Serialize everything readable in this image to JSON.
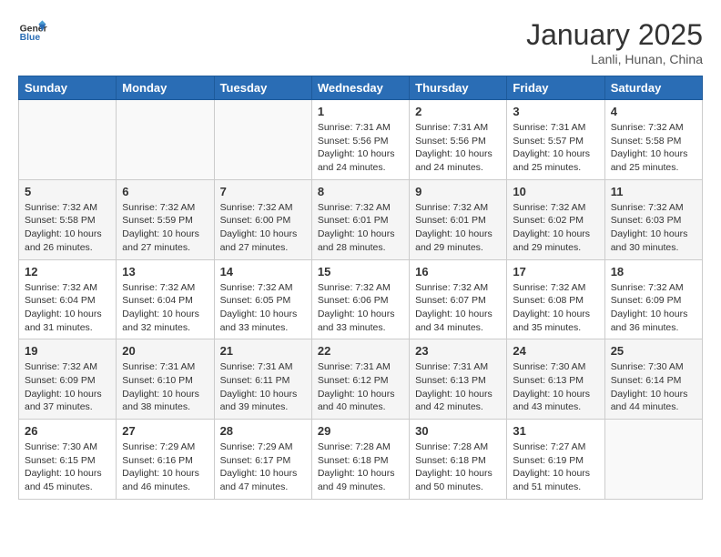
{
  "header": {
    "logo_line1": "General",
    "logo_line2": "Blue",
    "month_title": "January 2025",
    "location": "Lanli, Hunan, China"
  },
  "weekdays": [
    "Sunday",
    "Monday",
    "Tuesday",
    "Wednesday",
    "Thursday",
    "Friday",
    "Saturday"
  ],
  "weeks": [
    [
      {
        "day": "",
        "info": ""
      },
      {
        "day": "",
        "info": ""
      },
      {
        "day": "",
        "info": ""
      },
      {
        "day": "1",
        "info": "Sunrise: 7:31 AM\nSunset: 5:56 PM\nDaylight: 10 hours\nand 24 minutes."
      },
      {
        "day": "2",
        "info": "Sunrise: 7:31 AM\nSunset: 5:56 PM\nDaylight: 10 hours\nand 24 minutes."
      },
      {
        "day": "3",
        "info": "Sunrise: 7:31 AM\nSunset: 5:57 PM\nDaylight: 10 hours\nand 25 minutes."
      },
      {
        "day": "4",
        "info": "Sunrise: 7:32 AM\nSunset: 5:58 PM\nDaylight: 10 hours\nand 25 minutes."
      }
    ],
    [
      {
        "day": "5",
        "info": "Sunrise: 7:32 AM\nSunset: 5:58 PM\nDaylight: 10 hours\nand 26 minutes."
      },
      {
        "day": "6",
        "info": "Sunrise: 7:32 AM\nSunset: 5:59 PM\nDaylight: 10 hours\nand 27 minutes."
      },
      {
        "day": "7",
        "info": "Sunrise: 7:32 AM\nSunset: 6:00 PM\nDaylight: 10 hours\nand 27 minutes."
      },
      {
        "day": "8",
        "info": "Sunrise: 7:32 AM\nSunset: 6:01 PM\nDaylight: 10 hours\nand 28 minutes."
      },
      {
        "day": "9",
        "info": "Sunrise: 7:32 AM\nSunset: 6:01 PM\nDaylight: 10 hours\nand 29 minutes."
      },
      {
        "day": "10",
        "info": "Sunrise: 7:32 AM\nSunset: 6:02 PM\nDaylight: 10 hours\nand 29 minutes."
      },
      {
        "day": "11",
        "info": "Sunrise: 7:32 AM\nSunset: 6:03 PM\nDaylight: 10 hours\nand 30 minutes."
      }
    ],
    [
      {
        "day": "12",
        "info": "Sunrise: 7:32 AM\nSunset: 6:04 PM\nDaylight: 10 hours\nand 31 minutes."
      },
      {
        "day": "13",
        "info": "Sunrise: 7:32 AM\nSunset: 6:04 PM\nDaylight: 10 hours\nand 32 minutes."
      },
      {
        "day": "14",
        "info": "Sunrise: 7:32 AM\nSunset: 6:05 PM\nDaylight: 10 hours\nand 33 minutes."
      },
      {
        "day": "15",
        "info": "Sunrise: 7:32 AM\nSunset: 6:06 PM\nDaylight: 10 hours\nand 33 minutes."
      },
      {
        "day": "16",
        "info": "Sunrise: 7:32 AM\nSunset: 6:07 PM\nDaylight: 10 hours\nand 34 minutes."
      },
      {
        "day": "17",
        "info": "Sunrise: 7:32 AM\nSunset: 6:08 PM\nDaylight: 10 hours\nand 35 minutes."
      },
      {
        "day": "18",
        "info": "Sunrise: 7:32 AM\nSunset: 6:09 PM\nDaylight: 10 hours\nand 36 minutes."
      }
    ],
    [
      {
        "day": "19",
        "info": "Sunrise: 7:32 AM\nSunset: 6:09 PM\nDaylight: 10 hours\nand 37 minutes."
      },
      {
        "day": "20",
        "info": "Sunrise: 7:31 AM\nSunset: 6:10 PM\nDaylight: 10 hours\nand 38 minutes."
      },
      {
        "day": "21",
        "info": "Sunrise: 7:31 AM\nSunset: 6:11 PM\nDaylight: 10 hours\nand 39 minutes."
      },
      {
        "day": "22",
        "info": "Sunrise: 7:31 AM\nSunset: 6:12 PM\nDaylight: 10 hours\nand 40 minutes."
      },
      {
        "day": "23",
        "info": "Sunrise: 7:31 AM\nSunset: 6:13 PM\nDaylight: 10 hours\nand 42 minutes."
      },
      {
        "day": "24",
        "info": "Sunrise: 7:30 AM\nSunset: 6:13 PM\nDaylight: 10 hours\nand 43 minutes."
      },
      {
        "day": "25",
        "info": "Sunrise: 7:30 AM\nSunset: 6:14 PM\nDaylight: 10 hours\nand 44 minutes."
      }
    ],
    [
      {
        "day": "26",
        "info": "Sunrise: 7:30 AM\nSunset: 6:15 PM\nDaylight: 10 hours\nand 45 minutes."
      },
      {
        "day": "27",
        "info": "Sunrise: 7:29 AM\nSunset: 6:16 PM\nDaylight: 10 hours\nand 46 minutes."
      },
      {
        "day": "28",
        "info": "Sunrise: 7:29 AM\nSunset: 6:17 PM\nDaylight: 10 hours\nand 47 minutes."
      },
      {
        "day": "29",
        "info": "Sunrise: 7:28 AM\nSunset: 6:18 PM\nDaylight: 10 hours\nand 49 minutes."
      },
      {
        "day": "30",
        "info": "Sunrise: 7:28 AM\nSunset: 6:18 PM\nDaylight: 10 hours\nand 50 minutes."
      },
      {
        "day": "31",
        "info": "Sunrise: 7:27 AM\nSunset: 6:19 PM\nDaylight: 10 hours\nand 51 minutes."
      },
      {
        "day": "",
        "info": ""
      }
    ]
  ]
}
